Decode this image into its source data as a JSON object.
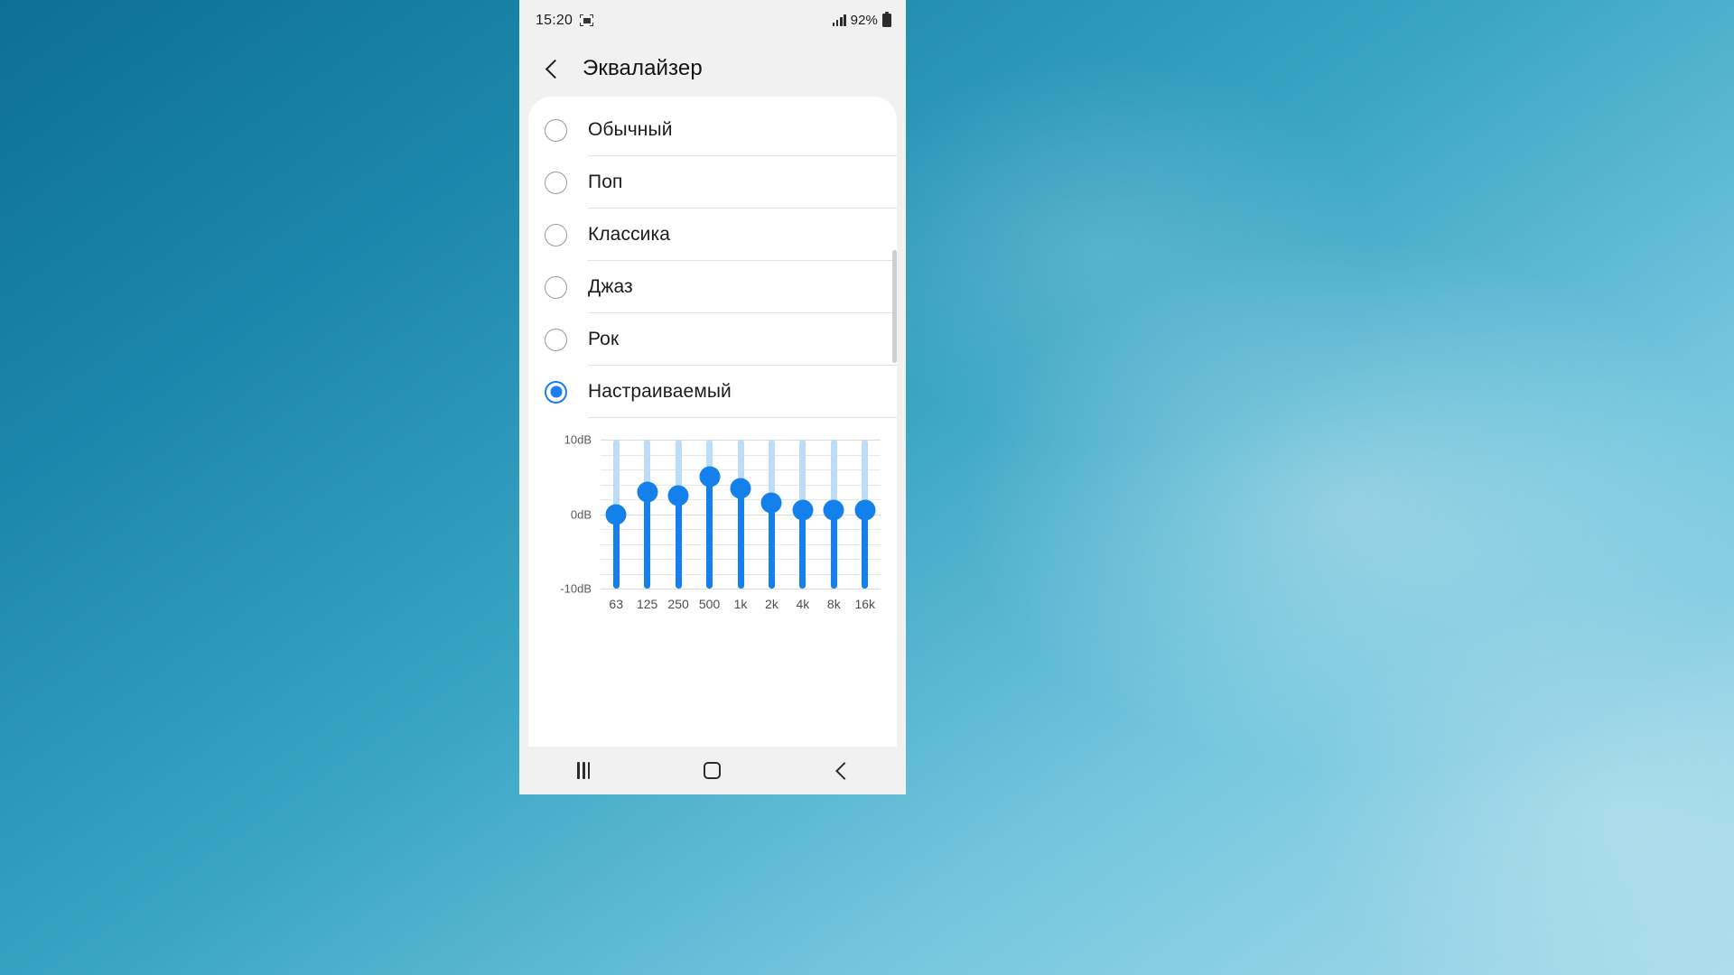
{
  "status_bar": {
    "time": "15:20",
    "capture_icon": "screenshot-capture-icon",
    "signal_icon": "signal-bars-icon",
    "battery_text": "92%",
    "battery_icon": "battery-full-icon"
  },
  "header": {
    "back_icon": "back-chevron-icon",
    "title": "Эквалайзер"
  },
  "presets": [
    {
      "label": "Обычный",
      "selected": false
    },
    {
      "label": "Поп",
      "selected": false
    },
    {
      "label": "Классика",
      "selected": false
    },
    {
      "label": "Джаз",
      "selected": false
    },
    {
      "label": "Рок",
      "selected": false
    },
    {
      "label": "Настраиваемый",
      "selected": true
    }
  ],
  "colors": {
    "accent": "#1380ec",
    "radio_selected": "#1a7ef0",
    "track_background": "#bcdcf7",
    "card_background": "#ffffff",
    "chrome_background": "#f1f1f1"
  },
  "chart_data": {
    "type": "bar",
    "title": "",
    "xlabel": "",
    "ylabel": "",
    "categories": [
      "63",
      "125",
      "250",
      "500",
      "1k",
      "2k",
      "4k",
      "8k",
      "16k"
    ],
    "values": [
      0,
      3,
      2.5,
      5,
      3.5,
      1.5,
      0.5,
      0.5,
      0.5
    ],
    "ylim": [
      -10,
      10
    ],
    "ytick_labels": [
      "10dB",
      "0dB",
      "-10dB"
    ],
    "ytick_values": [
      10,
      0,
      -10
    ],
    "gridlines": true,
    "grid_step": 2,
    "legend": "none",
    "units": "dB",
    "series": [
      {
        "name": "Настраиваемый",
        "values": [
          0,
          3,
          2.5,
          5,
          3.5,
          1.5,
          0.5,
          0.5,
          0.5
        ]
      }
    ]
  },
  "nav_bar": {
    "recents_icon": "recents-icon",
    "home_icon": "home-icon",
    "back_icon": "nav-back-icon"
  }
}
